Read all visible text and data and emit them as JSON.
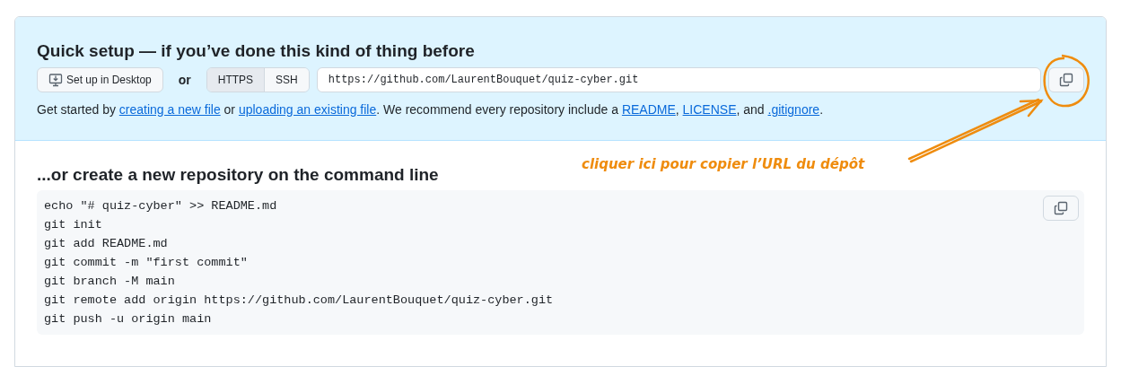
{
  "quick_setup": {
    "title": "Quick setup — if you’ve done this kind of thing before",
    "desktop_button": "Set up in Desktop",
    "or_label": "or",
    "protocols": [
      {
        "label": "HTTPS",
        "selected": true
      },
      {
        "label": "SSH",
        "selected": false
      }
    ],
    "clone_url": "https://github.com/LaurentBouquet/quiz-cyber.git",
    "description": [
      {
        "kind": "text",
        "text": "Get started by "
      },
      {
        "kind": "link",
        "text": "creating a new file"
      },
      {
        "kind": "text",
        "text": " or "
      },
      {
        "kind": "link",
        "text": "uploading an existing file"
      },
      {
        "kind": "text",
        "text": ". We recommend every repository include a "
      },
      {
        "kind": "link",
        "text": "README"
      },
      {
        "kind": "text",
        "text": ", "
      },
      {
        "kind": "link",
        "text": "LICENSE"
      },
      {
        "kind": "text",
        "text": ", and "
      },
      {
        "kind": "link",
        "text": ".gitignore"
      },
      {
        "kind": "text",
        "text": "."
      }
    ]
  },
  "command_line": {
    "title": "...or create a new repository on the command line",
    "lines": [
      "echo \"# quiz-cyber\" >> README.md",
      "git init",
      "git add README.md",
      "git commit -m \"first commit\"",
      "git branch -M main",
      "git remote add origin https://github.com/LaurentBouquet/quiz-cyber.git",
      "git push -u origin main"
    ]
  },
  "annotation": {
    "text": "cliquer ici pour copier l’URL du dépôt"
  }
}
